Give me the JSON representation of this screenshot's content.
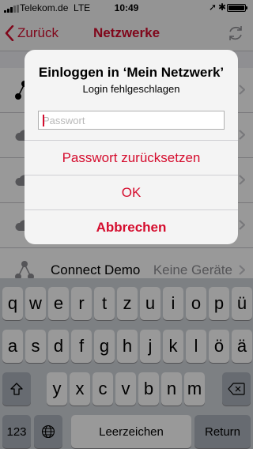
{
  "status_bar": {
    "carrier": "Telekom.de",
    "network": "LTE",
    "time": "10:49",
    "location_icon": "location-arrow-icon",
    "bluetooth_icon": "bluetooth-icon",
    "battery_level": 1.0
  },
  "nav": {
    "back_label": "Zurück",
    "title": "Netzwerke",
    "refresh_icon": "refresh-icon"
  },
  "list": {
    "rows": [
      {
        "name": "",
        "detail": ""
      },
      {
        "name": "",
        "detail": ""
      },
      {
        "name": "",
        "detail": ""
      },
      {
        "name": "",
        "detail": ""
      },
      {
        "name": "Connect Demo",
        "detail": "Keine Geräte"
      }
    ]
  },
  "alert": {
    "title": "Einloggen in ‘Mein Netzwerk’",
    "message": "Login fehlgeschlagen",
    "password_placeholder": "Passwort",
    "password_value": "",
    "reset_label": "Passwort zurücksetzen",
    "ok_label": "OK",
    "cancel_label": "Abbrechen"
  },
  "keyboard": {
    "row1": [
      "q",
      "w",
      "e",
      "r",
      "t",
      "z",
      "u",
      "i",
      "o",
      "p",
      "ü"
    ],
    "row2": [
      "a",
      "s",
      "d",
      "f",
      "g",
      "h",
      "j",
      "k",
      "l",
      "ö",
      "ä"
    ],
    "row3": [
      "y",
      "x",
      "c",
      "v",
      "b",
      "n",
      "m"
    ],
    "numbers_label": "123",
    "space_label": "Leerzeichen",
    "return_label": "Return"
  },
  "colors": {
    "accent": "#d50d2e",
    "keyboard_bg": "#d1d5db",
    "dark_key": "#acb3bc"
  }
}
